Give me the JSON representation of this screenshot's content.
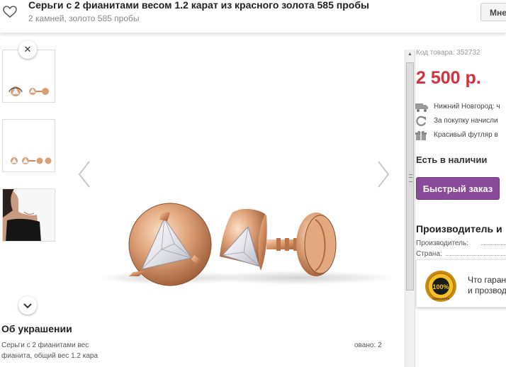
{
  "header": {
    "title": "Серьги с 2 фианитами весом 1.2 карат из красного золота 585 пробы",
    "subtitle": "2 камней, золото 585 пробы",
    "button_label": "Мне"
  },
  "description": {
    "title": "Об украшении",
    "line1": "Серьги с 2 фианитами вес",
    "line2": "фианита, общий вес 1.2 кара",
    "right_fragment": "овано: 2"
  },
  "panel": {
    "code": "Код товара: 352732",
    "price": "2 500 р.",
    "info": [
      {
        "icon": "truck-icon",
        "text": "Нижний Новгород: ч"
      },
      {
        "icon": "refresh-icon",
        "text": "За покупку начисли"
      },
      {
        "icon": "gift-icon",
        "text": "Красивый футляр в"
      }
    ],
    "stock": "Есть в наличии",
    "quick_order": "Быстрый заказ",
    "maker_title": "Производитель и",
    "maker_label": "Производитель:",
    "country_label": "Страна:",
    "guarantee_line1": "Что гаран",
    "guarantee_line2": "и прозвод",
    "seal_text_top": "100%",
    "seal_text_ring": "GUARANTEE"
  },
  "icons": {
    "favorite": "heart-icon",
    "thumb_up": "chevron-up-icon",
    "thumb_down": "chevron-down-icon",
    "prev": "chevron-left-icon",
    "next": "chevron-right-icon"
  },
  "colors": {
    "price": "#d6303c",
    "button": "#8a4a9a",
    "gold": "#d9a074"
  }
}
